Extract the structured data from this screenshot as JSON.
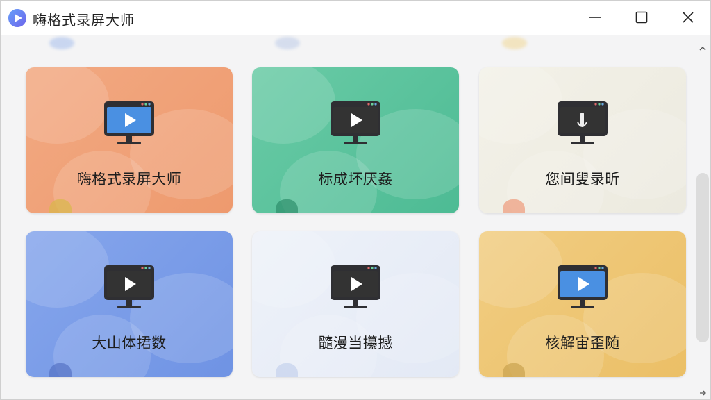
{
  "window": {
    "title": "嗨格式录屏大师",
    "controls": {
      "minimize": "minimize-icon",
      "maximize": "maximize-icon",
      "close": "close-icon"
    }
  },
  "cards": [
    {
      "label": "嗨格式录屏大师",
      "color": "#EE9A6E",
      "color2": "#F2A982",
      "icon": "play-icon",
      "screen": "#4A90E2",
      "badge": "#D9B84A"
    },
    {
      "label": "标成坏厌姦",
      "color": "#4DBB94",
      "color2": "#6ACBA6",
      "icon": "play-icon",
      "screen": "#333333",
      "badge": "#2E8E6B"
    },
    {
      "label": "您间叟录昕",
      "color": "#ECEADF",
      "color2": "#F3F1E8",
      "icon": "audio-icon",
      "screen": "#333333",
      "badge": "#EE9A7A"
    },
    {
      "label": "大山体捃数",
      "color": "#6F93E4",
      "color2": "#86A6EC",
      "icon": "play-icon",
      "screen": "#333333",
      "badge": "#5572C4"
    },
    {
      "label": "髓漫当攥撼",
      "color": "#E3E9F5",
      "color2": "#EEF2F9",
      "icon": "play-icon",
      "screen": "#333333",
      "badge": "#C5D1EC"
    },
    {
      "label": "核解宙歪随",
      "color": "#EBBF66",
      "color2": "#F1CD82",
      "icon": "play-icon",
      "screen": "#4A90E2",
      "badge": "#C9A24E"
    }
  ],
  "scrollbar": {
    "up_icon": "chevron-up-icon",
    "down_icon": "chevron-right-icon"
  }
}
